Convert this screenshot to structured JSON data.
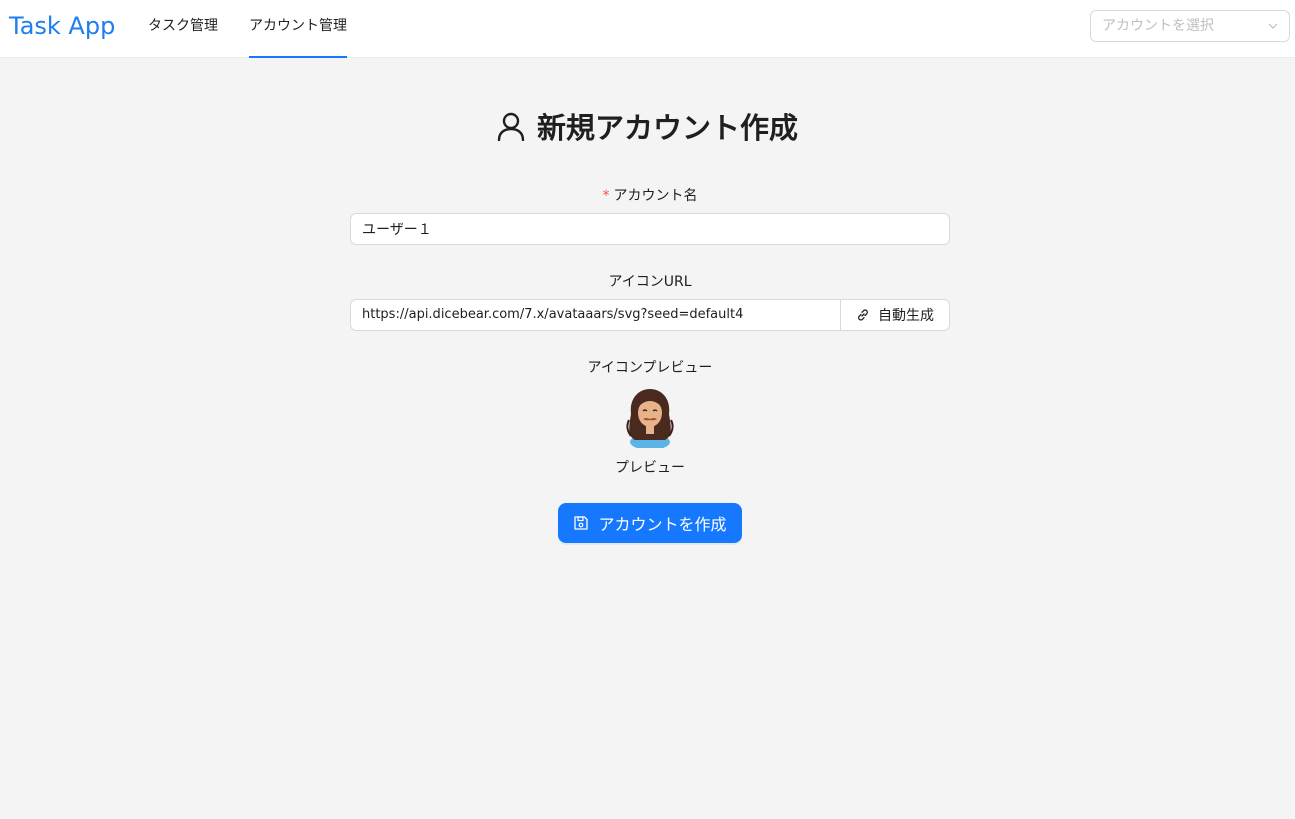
{
  "header": {
    "logo": "Task App",
    "tabs": [
      {
        "label": "タスク管理",
        "active": false
      },
      {
        "label": "アカウント管理",
        "active": true
      }
    ],
    "account_select_placeholder": "アカウントを選択"
  },
  "form": {
    "title": "新規アカウント作成",
    "title_icon": "user-icon",
    "name_label": "アカウント名",
    "name_required_mark": "*",
    "name_value": "ユーザー１",
    "icon_url_label": "アイコンURL",
    "icon_url_value": "https://api.dicebear.com/7.x/avataaars/svg?seed=default4",
    "auto_generate_label": "自動生成",
    "auto_generate_icon": "link-icon",
    "preview_label": "アイコンプレビュー",
    "preview_caption": "プレビュー",
    "submit_label": "アカウントを作成",
    "submit_icon": "save-icon"
  },
  "colors": {
    "accent": "#1677ff",
    "logo": "#1d7ef2",
    "required": "#ff4d4f",
    "background": "#f4f4f4"
  }
}
